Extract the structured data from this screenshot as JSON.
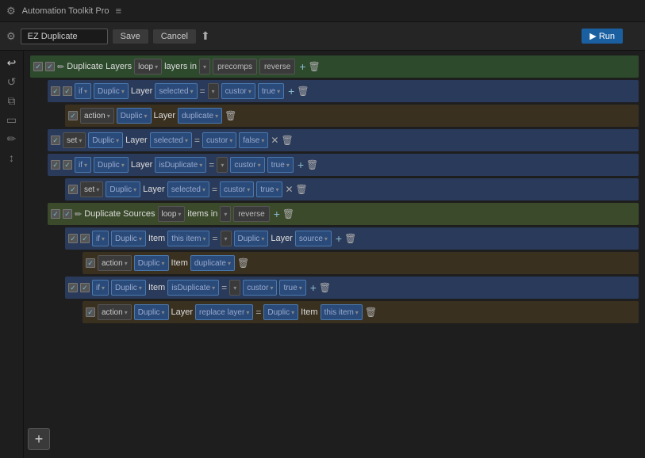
{
  "titleBar": {
    "appName": "Automation Toolkit Pro",
    "menuIcon": "≡"
  },
  "toolbar": {
    "scriptName": "EZ Duplicate",
    "saveLabel": "Save",
    "cancelLabel": "Cancel",
    "runLabel": "▶ Run",
    "uploadIcon": "⬆"
  },
  "sidebar": {
    "icons": [
      "↩",
      "↺",
      "⧉",
      "▭",
      "✏",
      "↕"
    ]
  },
  "rows": [
    {
      "id": "row1",
      "level": 0,
      "type": "loop-outer",
      "checks": [
        "checked",
        "checked"
      ],
      "hasPencil": true,
      "label": "Duplicate Layers",
      "keyword": "loop",
      "mid": "layers in",
      "tag": "precomps",
      "tag2": "reverse",
      "hasPlus": true,
      "hasTrash": true
    },
    {
      "id": "row2",
      "level": 1,
      "type": "if",
      "checks": [
        "checked",
        "checked"
      ],
      "keyword": "if",
      "dropdowns": [
        "Duplic ▾",
        "Layer",
        "selected ▾",
        "=",
        "custor ▾",
        "true ▾"
      ],
      "hasPlus": true,
      "hasTrash": true
    },
    {
      "id": "row3",
      "level": 2,
      "type": "action",
      "checks": [
        "checked"
      ],
      "keyword": "action",
      "dropdowns": [
        "Duplic ▾",
        "Layer",
        "duplicate ▾"
      ],
      "hasTrash": true
    },
    {
      "id": "row4",
      "level": 1,
      "type": "set",
      "checks": [
        "checked"
      ],
      "keyword": "set",
      "dropdowns": [
        "Duplic ▾",
        "Layer",
        "selected ▾",
        "=",
        "custor ▾",
        "false ▾"
      ],
      "hasX": true,
      "hasTrash": true
    },
    {
      "id": "row5",
      "level": 1,
      "type": "if",
      "checks": [
        "checked",
        "checked"
      ],
      "keyword": "if",
      "dropdowns": [
        "Duplic ▾",
        "Layer",
        "isDuplicate ▾",
        "=",
        "custor ▾",
        "true ▾"
      ],
      "hasPlus": true,
      "hasTrash": true
    },
    {
      "id": "row6",
      "level": 2,
      "type": "set",
      "checks": [
        "checked"
      ],
      "keyword": "set",
      "dropdowns": [
        "Duplic ▾",
        "Layer",
        "selected ▾",
        "=",
        "custor ▾",
        "true ▾"
      ],
      "hasX": true,
      "hasTrash": true
    },
    {
      "id": "row7",
      "level": 1,
      "type": "loop-inner",
      "checks": [
        "checked",
        "checked"
      ],
      "hasPencil": true,
      "label": "Duplicate Sources",
      "keyword": "loop",
      "mid": "items in",
      "tag": "reverse",
      "hasPlus": true,
      "hasTrash": true
    },
    {
      "id": "row8",
      "level": 2,
      "type": "if",
      "checks": [
        "checked",
        "checked"
      ],
      "keyword": "if",
      "dropdowns": [
        "Duplic ▾",
        "Item",
        "this item ▾",
        "=",
        "Duplic ▾",
        "Layer",
        "source ▾"
      ],
      "hasPlus": true,
      "hasTrash": true
    },
    {
      "id": "row9",
      "level": 3,
      "type": "action",
      "checks": [
        "checked"
      ],
      "keyword": "action",
      "dropdowns": [
        "Duplic ▾",
        "Item",
        "duplicate ▾"
      ],
      "hasTrash": true
    },
    {
      "id": "row10",
      "level": 2,
      "type": "if",
      "checks": [
        "checked",
        "checked"
      ],
      "keyword": "if",
      "dropdowns": [
        "Duplic ▾",
        "Item",
        "isDuplicate ▾",
        "=",
        "custor ▾",
        "true ▾"
      ],
      "hasPlus": true,
      "hasTrash": true
    },
    {
      "id": "row11",
      "level": 3,
      "type": "action",
      "checks": [
        "checked"
      ],
      "keyword": "action",
      "dropdowns": [
        "Duplic ▾",
        "Layer",
        "replace layer ▾",
        "=",
        "Duplic ▾",
        "Item",
        "this item ▾"
      ],
      "hasTrash": true
    }
  ],
  "addButton": "+"
}
